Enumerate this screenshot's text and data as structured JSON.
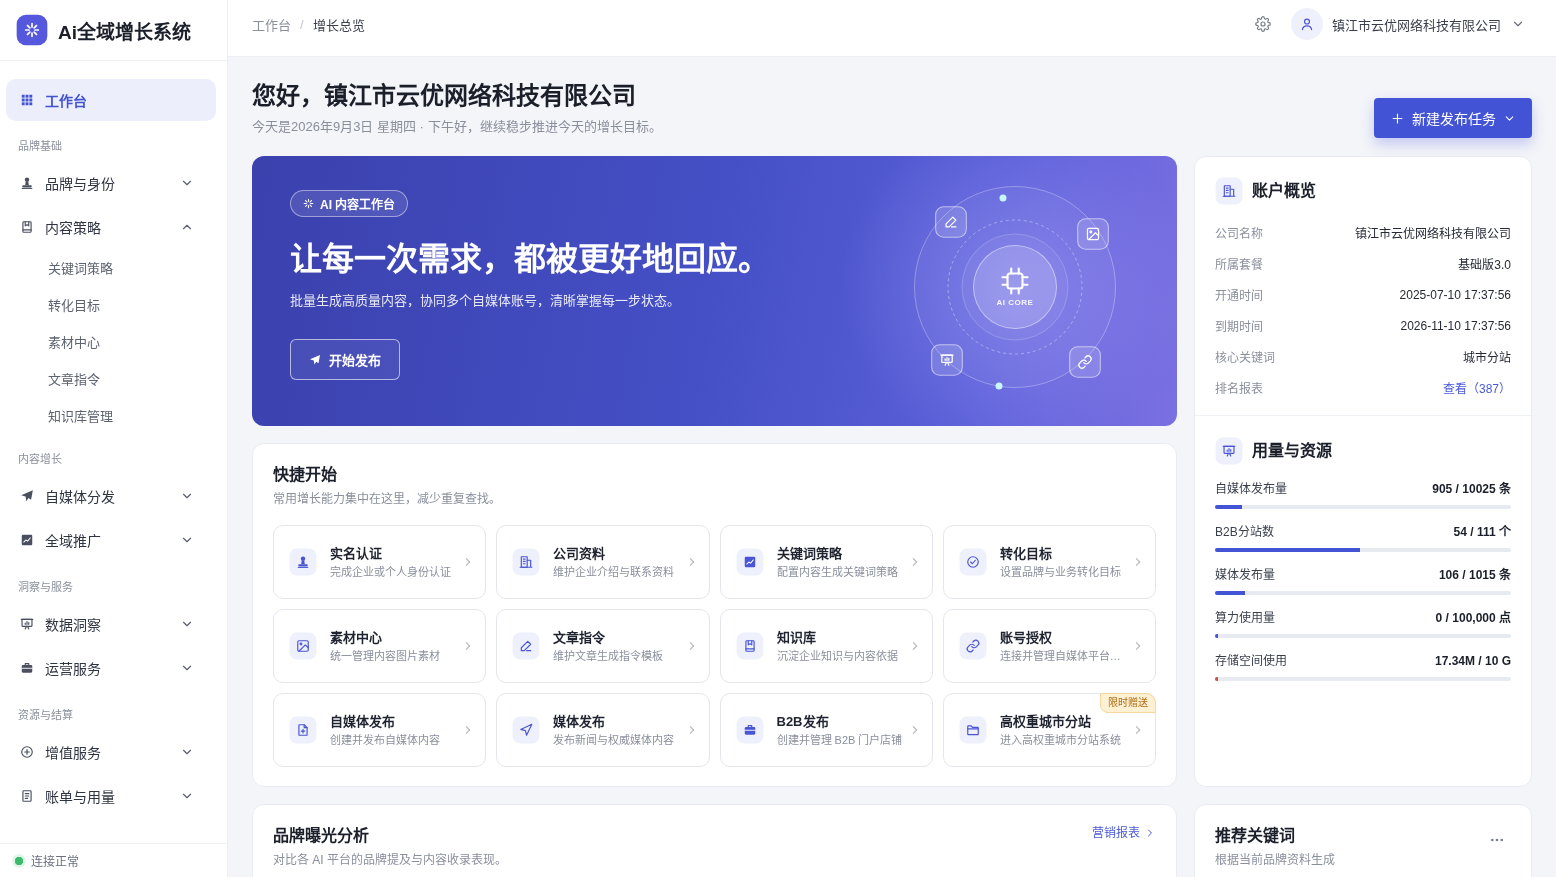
{
  "app": {
    "title": "Ai全域增长系统"
  },
  "sidebar": {
    "nav": [
      {
        "kind": "link",
        "label": "工作台",
        "selected": true
      },
      {
        "kind": "heading",
        "label": "品牌基础"
      },
      {
        "kind": "group",
        "label": "品牌与身份",
        "selected": false,
        "expanded": false
      },
      {
        "kind": "group",
        "label": "内容策略",
        "selected": false,
        "expanded": true,
        "children": [
          {
            "label": "关键词策略",
            "selected": false
          },
          {
            "label": "转化目标",
            "selected": false
          },
          {
            "label": "素材中心",
            "selected": false
          },
          {
            "label": "文章指令",
            "selected": false
          },
          {
            "label": "知识库管理",
            "selected": false
          }
        ]
      },
      {
        "kind": "heading",
        "label": "内容增长"
      },
      {
        "kind": "group",
        "label": "自媒体分发",
        "selected": false,
        "expanded": false
      },
      {
        "kind": "group",
        "label": "全域推广",
        "selected": false,
        "expanded": false
      },
      {
        "kind": "heading",
        "label": "洞察与服务"
      },
      {
        "kind": "group",
        "label": "数据洞察",
        "selected": false,
        "expanded": false
      },
      {
        "kind": "group",
        "label": "运营服务",
        "selected": false,
        "expanded": false
      },
      {
        "kind": "heading",
        "label": "资源与结算"
      },
      {
        "kind": "group",
        "label": "增值服务",
        "selected": false,
        "expanded": false
      },
      {
        "kind": "group",
        "label": "账单与用量",
        "selected": false,
        "expanded": false
      }
    ],
    "status": {
      "label": "连接正常",
      "online": true
    }
  },
  "topbar": {
    "breadcrumb": [
      {
        "label": "工作台",
        "selected": false
      },
      {
        "label": "增长总览",
        "selected": true
      }
    ],
    "separator": "/",
    "user": {
      "name": "镇江市云优网络科技有限公司"
    }
  },
  "greeting": {
    "title": "您好，镇江市云优网络科技有限公司",
    "subtitle": "今天是2026年9月3日 星期四 · 下午好，继续稳步推进今天的增长目标。",
    "button": "新建发布任务"
  },
  "hero": {
    "badge": "AI 内容工作台",
    "headline": "让每一次需求，都被更好地回应。",
    "description": "批量生成高质量内容，协同多个自媒体账号，清晰掌握每一步状态。",
    "button": "开始发布",
    "core_label": "AI CORE"
  },
  "quick_start": {
    "title": "快捷开始",
    "subtitle": "常用增长能力集中在这里，减少重复查找。",
    "items": [
      {
        "title": "实名认证",
        "description": "完成企业或个人身份认证"
      },
      {
        "title": "公司资料",
        "description": "维护企业介绍与联系资料"
      },
      {
        "title": "关键词策略",
        "description": "配置内容生成关键词策略"
      },
      {
        "title": "转化目标",
        "description": "设置品牌与业务转化目标"
      },
      {
        "title": "素材中心",
        "description": "统一管理内容图片素材"
      },
      {
        "title": "文章指令",
        "description": "维护文章生成指令模板"
      },
      {
        "title": "知识库",
        "description": "沉淀企业知识与内容依据"
      },
      {
        "title": "账号授权",
        "description": "连接并管理自媒体平台…"
      },
      {
        "title": "自媒体发布",
        "description": "创建并发布自媒体内容"
      },
      {
        "title": "媒体发布",
        "description": "发布新闻与权威媒体内容"
      },
      {
        "title": "B2B发布",
        "description": "创建并管理 B2B 门户店铺"
      },
      {
        "title": "高权重城市分站",
        "description": "进入高权重城市分站系统",
        "badge": "限时赠送"
      }
    ]
  },
  "account": {
    "title": "账户概览",
    "rows": [
      {
        "label": "公司名称",
        "value": "镇江市云优网络科技有限公司",
        "kind": "text"
      },
      {
        "label": "所属套餐",
        "value": "基础版3.0",
        "kind": "text"
      },
      {
        "label": "开通时间",
        "value": "2025-07-10 17:37:56",
        "kind": "text"
      },
      {
        "label": "到期时间",
        "value": "2026-11-10 17:37:56",
        "kind": "text"
      },
      {
        "label": "核心关键词",
        "value": "城市分站",
        "kind": "text"
      },
      {
        "label": "排名报表",
        "value": "查看（387）",
        "kind": "link"
      }
    ]
  },
  "usage": {
    "title": "用量与资源",
    "items": [
      {
        "label": "自媒体发布量",
        "reading": "905 / 10025 条",
        "level": 0.09,
        "color": "#4353d6"
      },
      {
        "label": "B2B分站数",
        "reading": "54 / 111 个",
        "level": 0.49,
        "color": "#4353d6"
      },
      {
        "label": "媒体发布量",
        "reading": "106 / 1015 条",
        "level": 0.1,
        "color": "#4353d6"
      },
      {
        "label": "算力使用量",
        "reading": "0 / 100,000 点",
        "level": 0.01,
        "color": "#4353d6"
      },
      {
        "label": "存储空间使用",
        "reading": "17.34M / 10 G",
        "level": 0.01,
        "color": "#d0523e"
      }
    ]
  },
  "brand_exposure": {
    "title": "品牌曝光分析",
    "subtitle": "对比各 AI 平台的品牌提及与内容收录表现。",
    "link": "营销报表"
  },
  "keywords": {
    "title": "推荐关键词",
    "subtitle": "根据当前品牌资料生成"
  }
}
